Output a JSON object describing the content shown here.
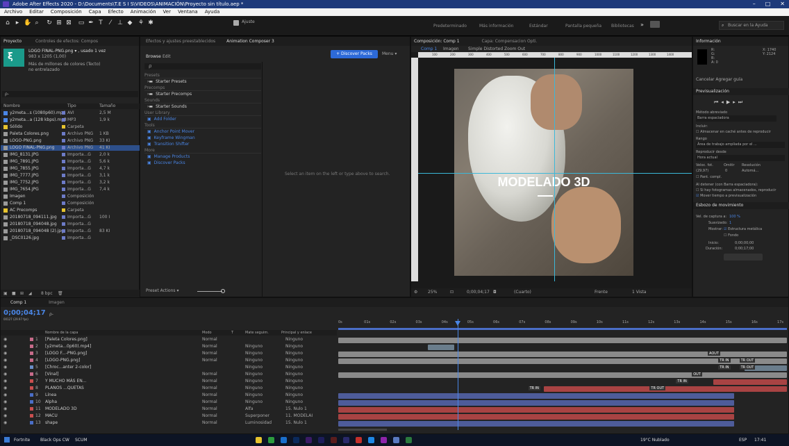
{
  "window": {
    "title": "Adobe After Effects 2020 - D:\\Documents\\T.E S I S\\VIDEOS\\ANIMACIÓN\\Proyecto sin título.aep *",
    "controls": [
      "–",
      "□",
      "✕"
    ]
  },
  "menu": [
    "Archivo",
    "Editar",
    "Composición",
    "Capa",
    "Efecto",
    "Animación",
    "Ver",
    "Ventana",
    "Ayuda"
  ],
  "toolbar": {
    "ajuste": "Ajuste",
    "workspaces": [
      "Predeterminado",
      "Más información",
      "Estándar",
      "Pantalla pequeña",
      "Bibliotecas"
    ],
    "search_placeholder": "Buscar en la Ayuda"
  },
  "project": {
    "tabs": [
      "Proyecto",
      "Controles de efectos: Compos"
    ],
    "item_name": "LOGO FINAL-PNG.png ▾ , usado 1 vez",
    "item_dims": "983 x 1205 (1,00)",
    "item_color": "Más de millones de colores (Tecto)",
    "item_interlace": "no entrelazado",
    "search_placeholder": "ρ-",
    "cols": [
      "Nombre",
      "Tipo",
      "Tamaño"
    ],
    "items": [
      {
        "name": "y2meta...s (1080p60).mp4",
        "type": "AVI",
        "size": "2,5 M",
        "color": "#4a86e6"
      },
      {
        "name": "y2meta...a (128 kbps).mp3",
        "type": "MP3",
        "size": "1,9 k",
        "color": "#4a86e6"
      },
      {
        "name": "Sólido",
        "type": "Carpeta",
        "size": "",
        "color": "#e6c32e"
      },
      {
        "name": "Paleta Colores.png",
        "type": "Archivo PNG",
        "size": "1 KB",
        "color": "#9a9a9a"
      },
      {
        "name": "LOGO-PNG.png",
        "type": "Archivo PNG",
        "size": "33 KI",
        "color": "#9a9a9a"
      },
      {
        "name": "LOGO FINAL-PNG.png",
        "type": "Archivo PNG",
        "size": "41 KI",
        "color": "#9a9a9a"
      },
      {
        "name": "IMG_8131.JPG",
        "type": "Importa...G",
        "size": "2,0 k",
        "color": "#9a9a9a"
      },
      {
        "name": "IMG_7891.JPG",
        "type": "Importa...G",
        "size": "5,6 k",
        "color": "#9a9a9a"
      },
      {
        "name": "IMG_7855.JPG",
        "type": "Importa...G",
        "size": "4,7 k",
        "color": "#9a9a9a"
      },
      {
        "name": "IMG_7777.JPG",
        "type": "Importa...G",
        "size": "3,1 k",
        "color": "#9a9a9a"
      },
      {
        "name": "IMG_7752.JPG",
        "type": "Importa...G",
        "size": "3,2 k",
        "color": "#9a9a9a"
      },
      {
        "name": "IMG_7654.JPG",
        "type": "Importa...G",
        "size": "7,4 k",
        "color": "#9a9a9a"
      },
      {
        "name": "Imagen",
        "type": "Composición",
        "size": "",
        "color": "#9a9a9a"
      },
      {
        "name": "Comp 1",
        "type": "Composición",
        "size": "",
        "color": "#9a9a9a"
      },
      {
        "name": "AC Precomps",
        "type": "Carpeta",
        "size": "",
        "color": "#e6c32e"
      },
      {
        "name": "20180718_094111.jpg",
        "type": "Importa...G",
        "size": "100 I",
        "color": "#9a9a9a"
      },
      {
        "name": "20180718_094048.jpg",
        "type": "Importa...G",
        "size": "",
        "color": "#9a9a9a"
      },
      {
        "name": "20180718_094048 (2).jpg",
        "type": "Importa...G",
        "size": "83 KI",
        "color": "#9a9a9a"
      },
      {
        "name": "_DSC0126.jpg",
        "type": "Importa...G",
        "size": "",
        "color": "#9a9a9a"
      }
    ],
    "bpc": "8 bpc"
  },
  "composer": {
    "tab": "Animation Composer 3",
    "browse": "Browse",
    "edit": "Edit",
    "discover": "+ Discover Packs",
    "menu": "Menu ▾",
    "search": "ρ",
    "sections": [
      {
        "head": "Presets",
        "items": [
          "Starter Presets"
        ]
      },
      {
        "head": "Precomps",
        "items": [
          "Starter Precomps"
        ]
      },
      {
        "head": "Sounds",
        "items": [
          "Starter Sounds"
        ]
      },
      {
        "head": "User Library",
        "items": [
          "Add Folder"
        ]
      },
      {
        "head": "Tools",
        "items": [
          "Anchor Point Mover",
          "Keyframe Wingman",
          "Transition Shifter"
        ]
      },
      {
        "head": "More",
        "items": [
          "Manage Products",
          "Discover Packs"
        ]
      }
    ],
    "hint": "Select an item on the left or type above to search.",
    "preset_actions": "Preset Actions ▾"
  },
  "viewer": {
    "tabs": [
      "Composición: Comp 1",
      "Capa: Compensacion Opti."
    ],
    "crumbs": [
      "Comp 1",
      "Imagen",
      "Simple Distorted Zoom Out"
    ],
    "ruler": [
      "100",
      "200",
      "300",
      "400",
      "500",
      "600",
      "700",
      "800",
      "900",
      "1000",
      "1100",
      "1200",
      "1300",
      "1400"
    ],
    "overlay": "MODELADO 3D",
    "footer": {
      "zoom": "25%",
      "time": "0;00;04;17",
      "res": "(Cuarto)",
      "view": "Frente",
      "views": "1 Vista"
    }
  },
  "info": {
    "title": "Información",
    "r": "R:",
    "g": "G:",
    "b": "B:",
    "a": "A: 0",
    "x": "X: 1740",
    "y": "Y: 2124",
    "cancel": "Cancelar Agregar guía",
    "preview": "Previsualización",
    "method_label": "Método abreviado",
    "method": "Barra espaciadora",
    "include": "Incluir:",
    "cache": "Almacenar en caché antes de reproducir",
    "range_label": "Rango",
    "range": "Área de trabajo ampliada por el ...",
    "play_from_label": "Reproducir desde",
    "play_from": "Hora actual",
    "fps_label": "Veloc. fot.",
    "skip_label": "Omitir",
    "res_label": "Resolución",
    "fps": "(29,97)",
    "skip": "0",
    "res": "Automá...",
    "fullscreen": "Pant. compl.",
    "stop_label": "Al detener (con Barra espaciadora):",
    "stop1": "Si hay fotogramas almacenados, reproducir",
    "stop2": "Mover tiempo a previsualización",
    "motion": "Esbozo de movimiento",
    "capture_label": "Vel. de captura a:",
    "capture": "100 %",
    "smooth_label": "Suavizado:",
    "smooth": "1",
    "show_label": "Mostrar:",
    "wire": "Estructura metálica",
    "bg": "Fondo",
    "start_label": "Inicio:",
    "start": "0;00;00;00",
    "dur_label": "Duración:",
    "dur": "0;00;17;00"
  },
  "timeline": {
    "tabs": [
      "Comp 1",
      "Imagen"
    ],
    "time": "0;00;04;17",
    "time_sub": "00127 (29.97 fps)",
    "search": "ρ-",
    "cols": [
      "Nombre de la capa",
      "Modo",
      "T",
      "Mate seguim.",
      "Principal y enlace"
    ],
    "ticks": [
      "0s",
      "01s",
      "02s",
      "03s",
      "04s",
      "05s",
      "06s",
      "07s",
      "08s",
      "09s",
      "10s",
      "11s",
      "12s",
      "13s",
      "14s",
      "15s",
      "16s",
      "17s"
    ],
    "layers": [
      {
        "n": "1",
        "name": "[Paleta Colores.png]",
        "mode": "Normal",
        "mate": "",
        "parent": "Ninguno",
        "color": "#c76b8a"
      },
      {
        "n": "2",
        "name": "[y2meta...0p60).mp4]",
        "mode": "Normal",
        "mate": "Ninguno",
        "parent": "Ninguno",
        "color": "#c76b8a"
      },
      {
        "n": "3",
        "name": "[LOGO F...-PNG.png]",
        "mode": "Normal",
        "mate": "Ninguno",
        "parent": "Ninguno",
        "color": "#c76b8a"
      },
      {
        "n": "4",
        "name": "[LOGO-PNG.png]",
        "mode": "Normal",
        "mate": "Ninguno",
        "parent": "Ninguno",
        "color": "#c76b8a"
      },
      {
        "n": "5",
        "name": "[Chroc...anter 2-color]",
        "mode": "",
        "mate": "Ninguno",
        "parent": "Ninguno",
        "color": "#6a8dc7"
      },
      {
        "n": "6",
        "name": "[Vinal]",
        "mode": "Normal",
        "mate": "Ninguno",
        "parent": "Ninguno",
        "color": "#c76b8a"
      },
      {
        "n": "7",
        "name": "Y MUCHO MÁS EN...",
        "mode": "Normal",
        "mate": "Ninguno",
        "parent": "Ninguno",
        "color": "#c94f4f"
      },
      {
        "n": "8",
        "name": "PLANOS ...QUETAS",
        "mode": "Normal",
        "mate": "Ninguno",
        "parent": "Ninguno",
        "color": "#c94f4f"
      },
      {
        "n": "9",
        "name": "Línea",
        "mode": "Normal",
        "mate": "Ninguno",
        "parent": "Ninguno",
        "color": "#4a6ec7"
      },
      {
        "n": "10",
        "name": "Alpha",
        "mode": "Normal",
        "mate": "Ninguno",
        "parent": "Ninguno",
        "color": "#4a6ec7"
      },
      {
        "n": "11",
        "name": "MODELADO 3D",
        "mode": "Normal",
        "mate": "Alfa",
        "parent": "15. Nulo 1",
        "color": "#c94f4f"
      },
      {
        "n": "12",
        "name": "MACU",
        "mode": "Normal",
        "mate": "Superponer",
        "parent": "11. MODELAI",
        "color": "#c94f4f"
      },
      {
        "n": "13",
        "name": "shape",
        "mode": "Normal",
        "mate": "Luminosidad",
        "parent": "15. Nulo 1",
        "color": "#4a6ec7"
      }
    ],
    "kf_labels": [
      "AOUT",
      "TR IN",
      "TR OUT",
      "TR IN",
      "TR OUT",
      "OUT",
      "TR IN",
      "TR IN",
      "TR OUT"
    ]
  },
  "taskbar": {
    "apps": [
      "Fortnite",
      "Black Ops CW",
      "SCUM"
    ],
    "weather": "19°C Nublado",
    "lang": "ESP",
    "time": "17:41"
  }
}
